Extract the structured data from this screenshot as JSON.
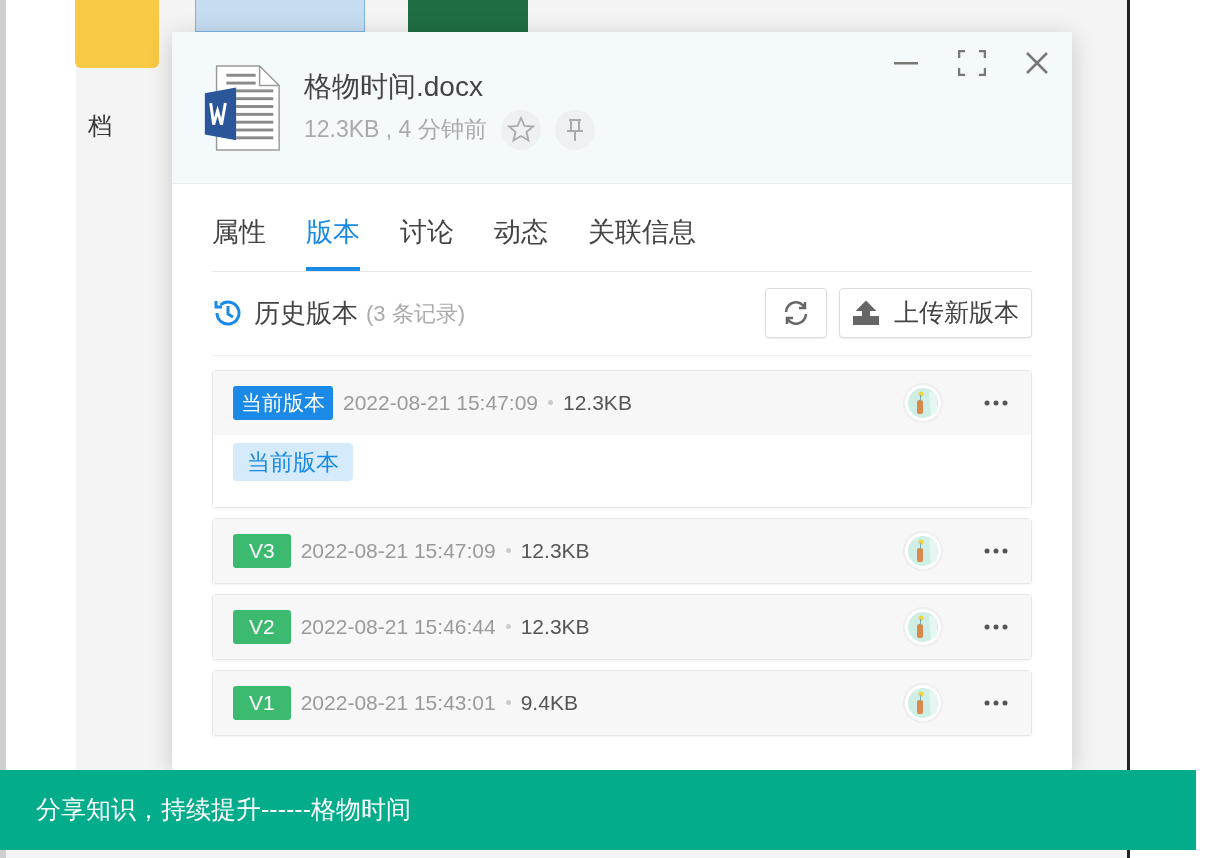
{
  "background": {
    "folder_label": "档"
  },
  "dialog": {
    "file_name": "格物时间.docx",
    "file_meta": "12.3KB , 4 分钟前",
    "tabs": [
      {
        "label": "属性",
        "selected": false
      },
      {
        "label": "版本",
        "selected": true
      },
      {
        "label": "讨论",
        "selected": false
      },
      {
        "label": "动态",
        "selected": false
      },
      {
        "label": "关联信息",
        "selected": false
      }
    ],
    "history": {
      "title": "历史版本",
      "count": "(3 条记录)",
      "upload_button": "上传新版本"
    },
    "versions": [
      {
        "kind": "current",
        "badge": "当前版本",
        "date": "2022-08-21 15:47:09",
        "size": "12.3KB",
        "tag": "当前版本"
      },
      {
        "kind": "version",
        "badge": "V3",
        "date": "2022-08-21 15:47:09",
        "size": "12.3KB"
      },
      {
        "kind": "version",
        "badge": "V2",
        "date": "2022-08-21 15:46:44",
        "size": "12.3KB"
      },
      {
        "kind": "version",
        "badge": "V1",
        "date": "2022-08-21 15:43:01",
        "size": "9.4KB"
      }
    ]
  },
  "banner": {
    "text": "分享知识，持续提升------格物时间"
  }
}
